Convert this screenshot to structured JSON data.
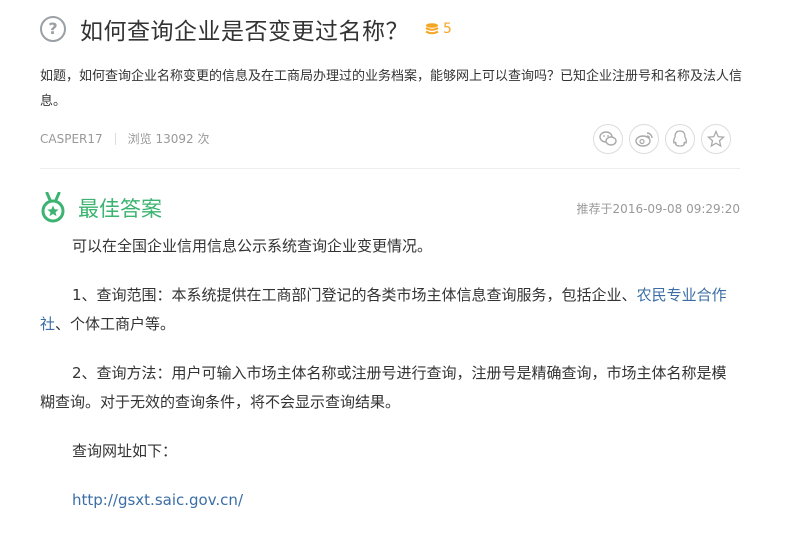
{
  "question": {
    "title": "如何查询企业是否变更过名称？",
    "reward": "5",
    "description": "如题，如何查询企业名称变更的信息及在工商局办理过的业务档案，能够网上可以查询吗？已知企业注册号和名称及法人信息。"
  },
  "meta": {
    "user": "CASPER17",
    "views": "浏览 13092 次"
  },
  "share_icons": [
    "wechat-icon",
    "weibo-icon",
    "qq-icon",
    "favorite-star-icon"
  ],
  "best_answer": {
    "label": "最佳答案",
    "recommended_time": "推荐于2016-09-08 09:29:20",
    "paragraph1": "可以在全国企业信用信息公示系统查询企业变更情况。",
    "paragraph2_before": "1、查询范围：本系统提供在工商部门登记的各类市场主体信息查询服务，包括企业、",
    "paragraph2_link": "农民专业合作社",
    "paragraph2_after": "、个体工商户等。",
    "paragraph3": "2、查询方法：用户可输入市场主体名称或注册号进行查询，注册号是精确查询，市场主体名称是模糊查询。对于无效的查询条件，将不会显示查询结果。",
    "paragraph4": "查询网址如下：",
    "url": "http://gsxt.saic.gov.cn/"
  },
  "colors": {
    "accent_green": "#3cb371",
    "reward_gold": "#f5a623",
    "link_blue": "#3a6ea5"
  }
}
